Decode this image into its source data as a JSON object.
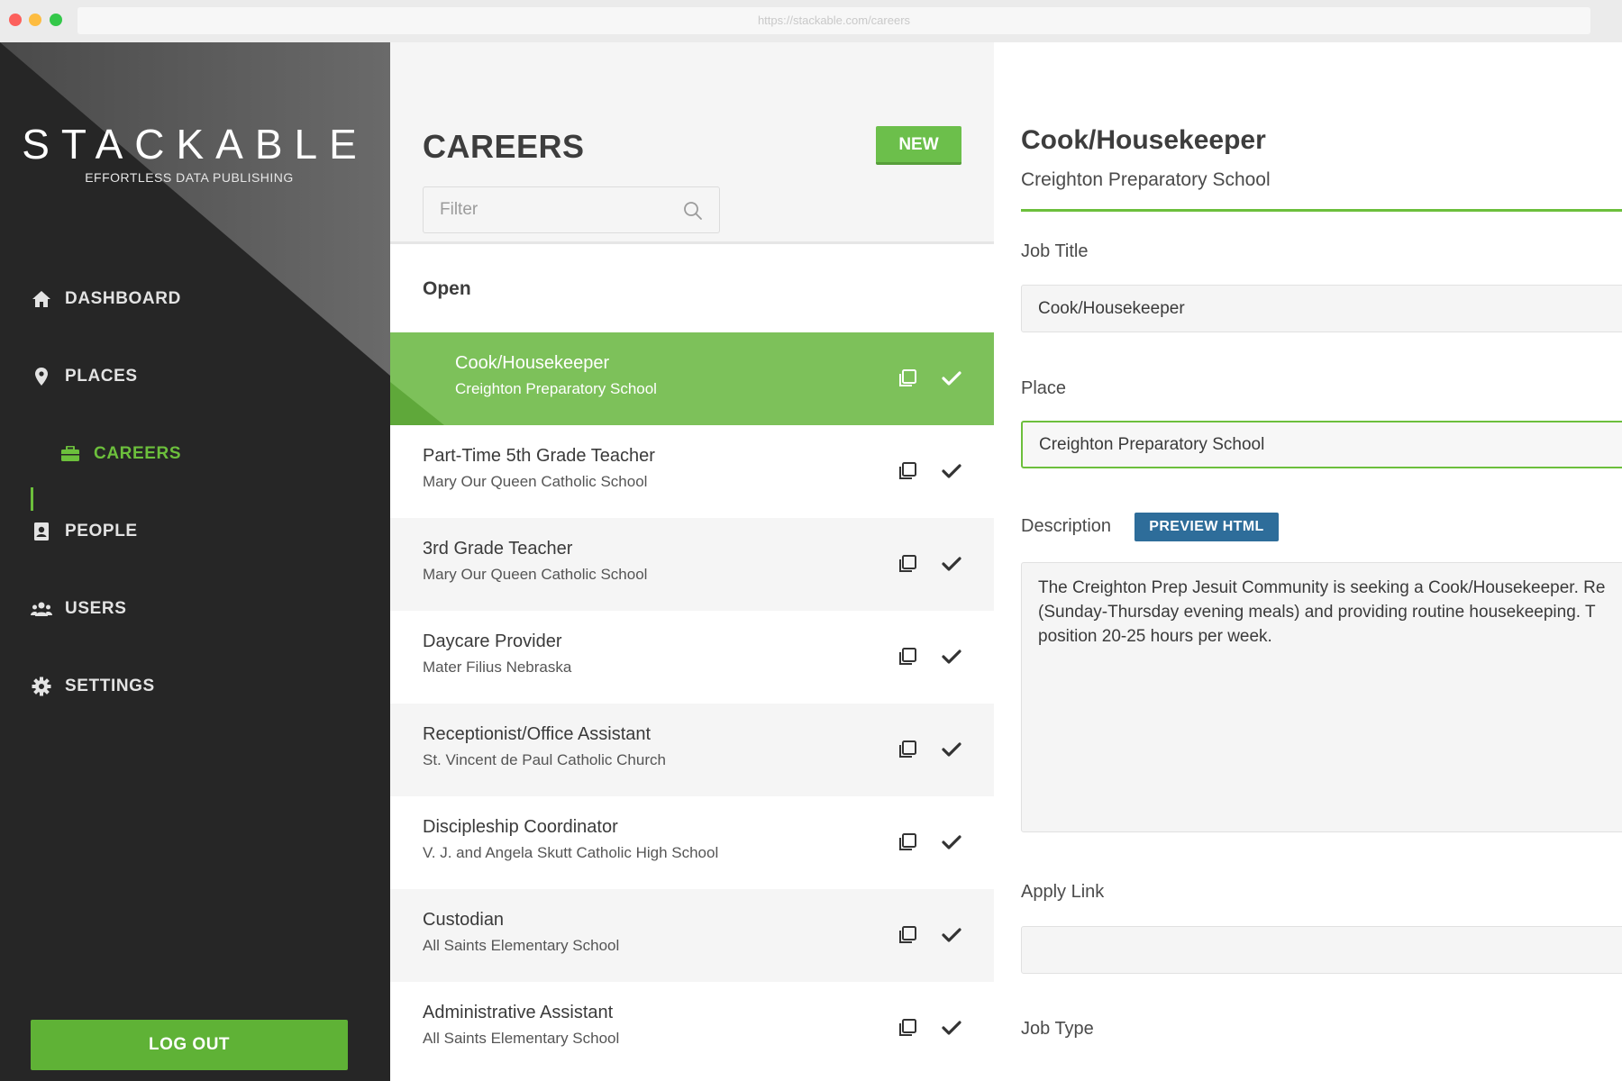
{
  "browser": {
    "url": "https://stackable.com/careers"
  },
  "sidebar": {
    "logo_title": "STACKABLE",
    "logo_subtitle": "EFFORTLESS DATA PUBLISHING",
    "items": [
      {
        "label": "DASHBOARD",
        "icon": "home-icon"
      },
      {
        "label": "PLACES",
        "icon": "map-pin-icon"
      },
      {
        "label": "CAREERS",
        "icon": "briefcase-icon",
        "active": true
      },
      {
        "label": "PEOPLE",
        "icon": "contact-book-icon"
      },
      {
        "label": "USERS",
        "icon": "users-icon"
      },
      {
        "label": "SETTINGS",
        "icon": "gear-icon"
      }
    ],
    "logout_label": "LOG OUT"
  },
  "list": {
    "title": "CAREERS",
    "new_label": "NEW",
    "filter_placeholder": "Filter",
    "group_label": "Open",
    "rows": [
      {
        "title": "Cook/Housekeeper",
        "place": "Creighton Preparatory School",
        "selected": true
      },
      {
        "title": "Part-Time 5th Grade Teacher",
        "place": "Mary Our Queen Catholic School"
      },
      {
        "title": "3rd Grade Teacher",
        "place": "Mary Our Queen Catholic School"
      },
      {
        "title": "Daycare Provider",
        "place": "Mater Filius Nebraska"
      },
      {
        "title": "Receptionist/Office Assistant",
        "place": "St. Vincent de Paul Catholic Church"
      },
      {
        "title": "Discipleship Coordinator",
        "place": "V. J. and Angela Skutt Catholic High School"
      },
      {
        "title": "Custodian",
        "place": "All Saints Elementary School"
      },
      {
        "title": "Administrative Assistant",
        "place": "All Saints Elementary School"
      }
    ]
  },
  "detail": {
    "title": "Cook/Housekeeper",
    "subtitle": "Creighton Preparatory School",
    "job_title_label": "Job Title",
    "job_title_value": "Cook/Housekeeper",
    "place_label": "Place",
    "place_value": "Creighton Preparatory School",
    "description_label": "Description",
    "preview_label": "PREVIEW HTML",
    "description_lines": [
      "The Creighton Prep Jesuit Community is seeking a Cook/Housekeeper. Re",
      "(Sunday-Thursday evening meals) and providing routine housekeeping. T",
      "position 20-25 hours per week."
    ],
    "apply_link_label": "Apply Link",
    "apply_link_value": "",
    "job_type_label": "Job Type"
  },
  "colors": {
    "accent_green": "#6cbf3c",
    "selected_row": "#7dc15a",
    "sidebar_bg": "#262626",
    "preview_blue": "#2e6d9a"
  }
}
